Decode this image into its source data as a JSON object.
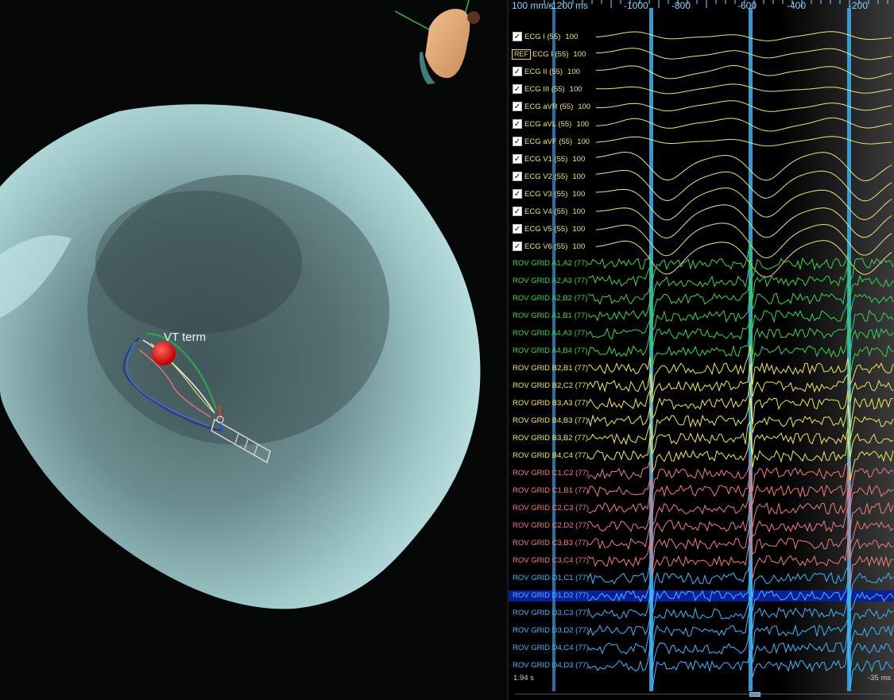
{
  "viewer3d": {
    "marker_label": "VT term"
  },
  "egm": {
    "sweep_speed": "100 mm/s",
    "time_axis": [
      {
        "label": "-1200 ms"
      },
      {
        "label": "-1000"
      },
      {
        "label": "-800"
      },
      {
        "label": "-600"
      },
      {
        "label": "-400"
      },
      {
        "label": "-200"
      }
    ],
    "ecg_leads": [
      {
        "name": "ECG I (55)",
        "gain": "100",
        "checked": true,
        "ref": false
      },
      {
        "name": "ECG I (55)",
        "gain": "100",
        "checked": false,
        "ref": true
      },
      {
        "name": "ECG II (55)",
        "gain": "100",
        "checked": true,
        "ref": false
      },
      {
        "name": "ECG III (55)",
        "gain": "100",
        "checked": true,
        "ref": false
      },
      {
        "name": "ECG aVR (55)",
        "gain": "100",
        "checked": true,
        "ref": false
      },
      {
        "name": "ECG aVL (55)",
        "gain": "100",
        "checked": true,
        "ref": false
      },
      {
        "name": "ECG aVF (55)",
        "gain": "100",
        "checked": true,
        "ref": false
      },
      {
        "name": "ECG V1 (55)",
        "gain": "100",
        "checked": true,
        "ref": false
      },
      {
        "name": "ECG V2 (55)",
        "gain": "100",
        "checked": true,
        "ref": false
      },
      {
        "name": "ECG V3 (55)",
        "gain": "100",
        "checked": true,
        "ref": false
      },
      {
        "name": "ECG V4 (55)",
        "gain": "100",
        "checked": true,
        "ref": false
      },
      {
        "name": "ECG V5 (55)",
        "gain": "100",
        "checked": true,
        "ref": false
      },
      {
        "name": "ECG V6 (55)",
        "gain": "100",
        "checked": true,
        "ref": false
      }
    ],
    "ref_badge": "REF",
    "rov_channels": [
      {
        "name": "ROV GRID A1,A2 (77)",
        "color": "#39d353"
      },
      {
        "name": "ROV GRID A2,A3 (77)",
        "color": "#39d353"
      },
      {
        "name": "ROV GRID A2,B2 (77)",
        "color": "#39d353"
      },
      {
        "name": "ROV GRID A1,B1 (77)",
        "color": "#39d353"
      },
      {
        "name": "ROV GRID A4,A3 (77)",
        "color": "#39d353"
      },
      {
        "name": "ROV GRID A4,B4 (77)",
        "color": "#39d353"
      },
      {
        "name": "ROV GRID B2,B1 (77)",
        "color": "#f2e85a"
      },
      {
        "name": "ROV GRID B2,C2 (77)",
        "color": "#f2e85a"
      },
      {
        "name": "ROV GRID B3,A3 (77)",
        "color": "#f2e85a"
      },
      {
        "name": "ROV GRID B4,B3 (77)",
        "color": "#f2e85a"
      },
      {
        "name": "ROV GRID B3,B2 (77)",
        "color": "#f2e85a"
      },
      {
        "name": "ROV GRID B4,C4 (77)",
        "color": "#f2e85a"
      },
      {
        "name": "ROV GRID C1,C2 (77)",
        "color": "#f07e7e"
      },
      {
        "name": "ROV GRID C1,B1 (77)",
        "color": "#f07e7e"
      },
      {
        "name": "ROV GRID C2,C3 (77)",
        "color": "#f07e7e"
      },
      {
        "name": "ROV GRID C2,D2 (77)",
        "color": "#f07e7e"
      },
      {
        "name": "ROV GRID C3,B3 (77)",
        "color": "#f07e7e"
      },
      {
        "name": "ROV GRID C3,C4 (77)",
        "color": "#f07e7e"
      },
      {
        "name": "ROV GRID D1,C1 (77)",
        "color": "#3fb6ff"
      },
      {
        "name": "ROV GRID D1,D2 (77)",
        "color": "#3fb6ff"
      },
      {
        "name": "ROV GRID D3,C3 (77)",
        "color": "#3fb6ff"
      },
      {
        "name": "ROV GRID D3,D2 (77)",
        "color": "#3fb6ff"
      },
      {
        "name": "ROV GRID D4,C4 (77)",
        "color": "#3fb6ff"
      },
      {
        "name": "ROV GRID D4,D3 (77)",
        "color": "#3fb6ff"
      }
    ],
    "footer_left": "1.94 s",
    "footer_right": "-35 ms"
  },
  "colors": {
    "ecg": "#f0e27a",
    "marker_lines": "#3aa0e0",
    "chamber": "#a9d2d3",
    "selected_row": "#0a1e9a"
  }
}
